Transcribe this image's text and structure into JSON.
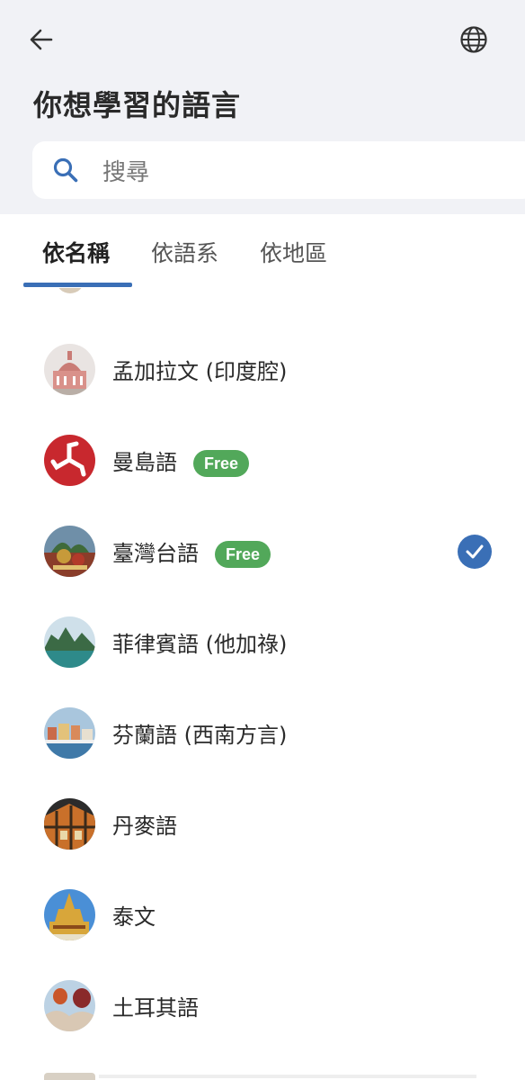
{
  "header": {
    "title": "你想學習的語言",
    "search_placeholder": "搜尋"
  },
  "tabs": [
    {
      "label": "依名稱",
      "active": true
    },
    {
      "label": "依語系",
      "active": false
    },
    {
      "label": "依地區",
      "active": false
    }
  ],
  "languages": [
    {
      "name": "孟加拉文 (印度腔)",
      "badge": "",
      "selected": false
    },
    {
      "name": "曼島語",
      "badge": "Free",
      "selected": false
    },
    {
      "name": "臺灣台語",
      "badge": "Free",
      "selected": true
    },
    {
      "name": "菲律賓語 (他加祿)",
      "badge": "",
      "selected": false
    },
    {
      "name": "芬蘭語 (西南方言)",
      "badge": "",
      "selected": false
    },
    {
      "name": "丹麥語",
      "badge": "",
      "selected": false
    },
    {
      "name": "泰文",
      "badge": "",
      "selected": false
    },
    {
      "name": "土耳其語",
      "badge": "",
      "selected": false
    }
  ],
  "colors": {
    "accent": "#3a6fb6",
    "free_badge": "#52a85a",
    "header_bg": "#f1f2f6"
  }
}
